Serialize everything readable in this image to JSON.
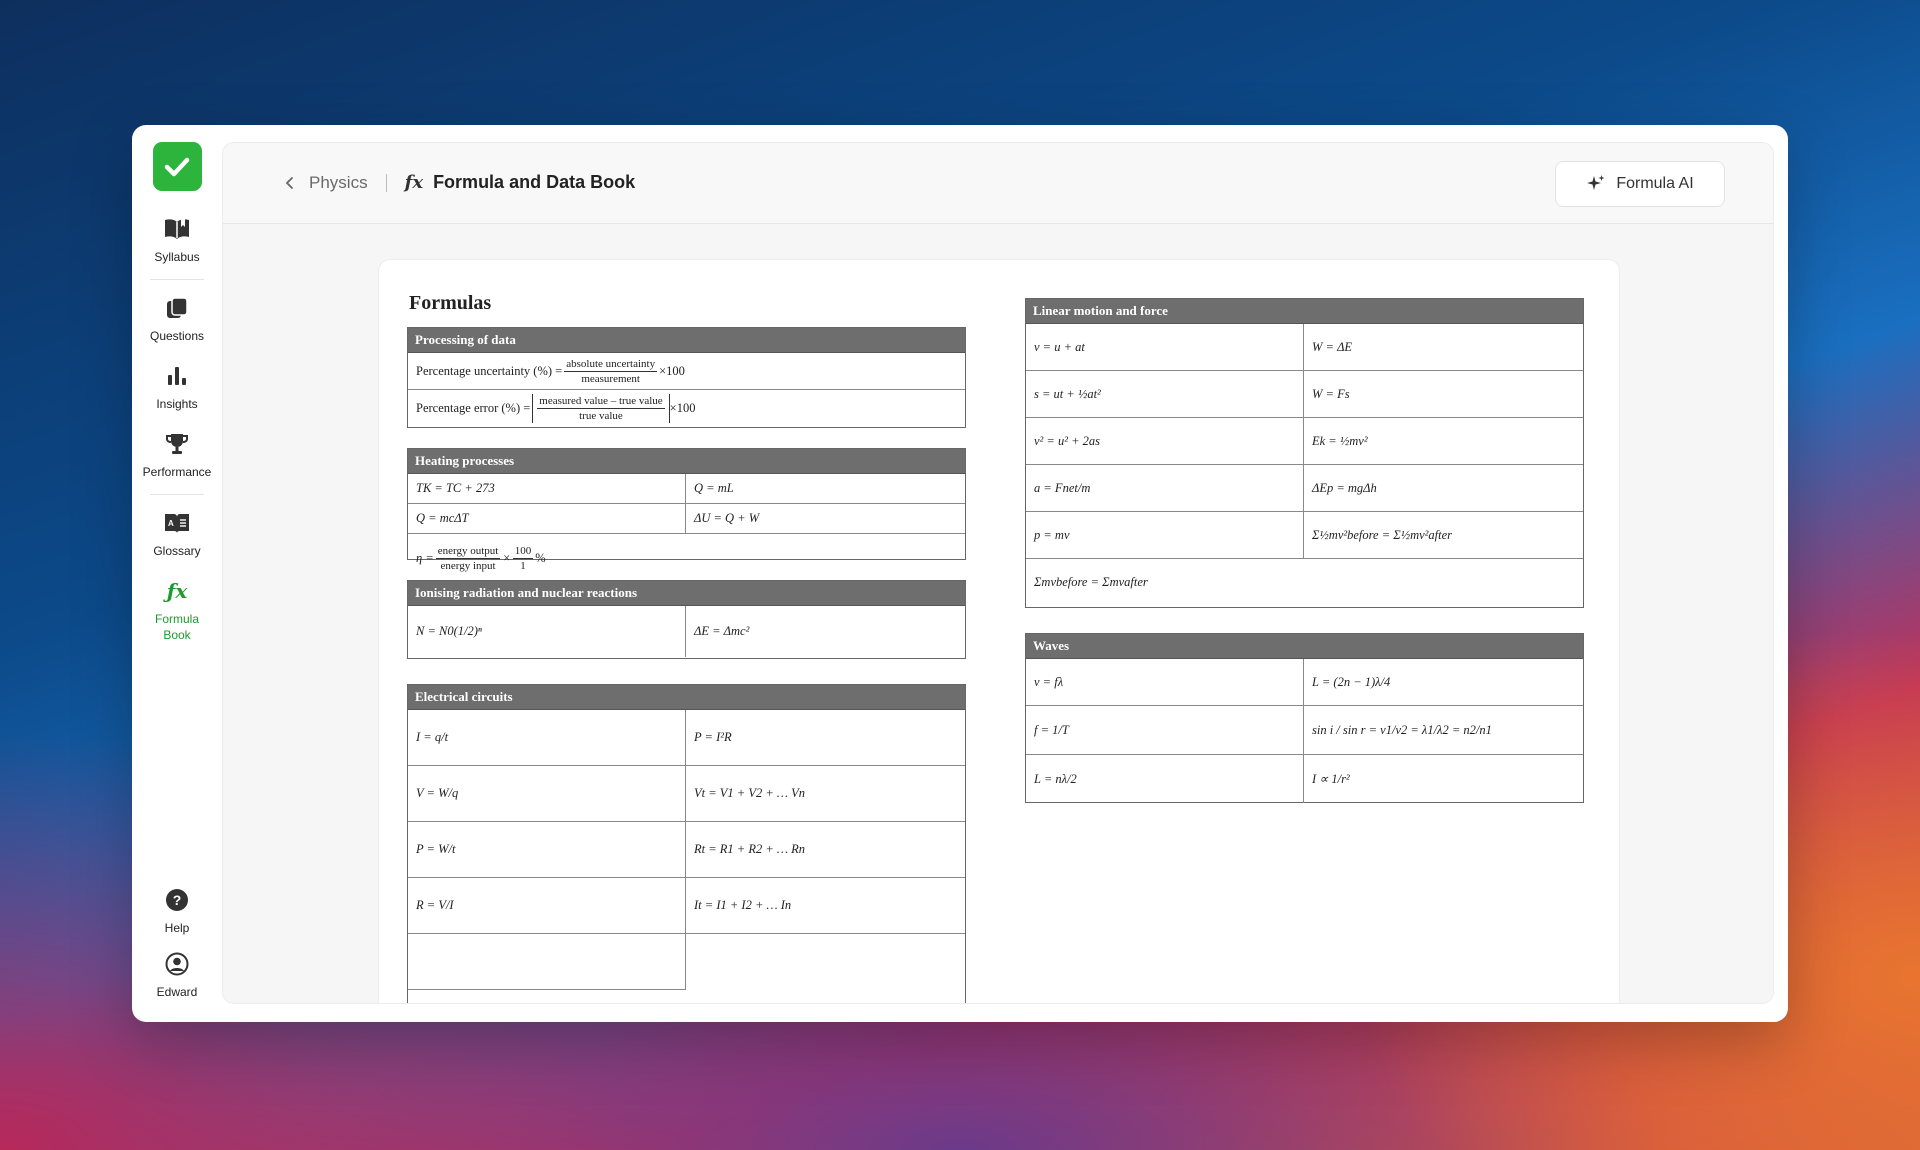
{
  "sidebar": {
    "items": [
      {
        "label": "Syllabus",
        "icon": "book-open-icon"
      },
      {
        "label": "Questions",
        "icon": "cards-icon"
      },
      {
        "label": "Insights",
        "icon": "bar-chart-icon"
      },
      {
        "label": "Performance",
        "icon": "trophy-icon"
      },
      {
        "label": "Glossary",
        "icon": "dictionary-icon"
      },
      {
        "label": "Formula Book",
        "icon": "fx-icon"
      }
    ],
    "help_label": "Help",
    "user_label": "Edward",
    "accent_color": "#1f9a2c"
  },
  "header": {
    "breadcrumb_parent": "Physics",
    "title_icon": "fx",
    "title": "Formula and Data Book",
    "ai_button": "Formula AI"
  },
  "doc": {
    "heading": "Formulas",
    "sections": {
      "processing": {
        "title": "Processing of data",
        "pct_uncertainty_lhs": "Percentage uncertainty (%) =",
        "pct_uncertainty_num": "absolute uncertainty",
        "pct_uncertainty_den": "measurement",
        "pct_uncertainty_mul": "×100",
        "pct_error_lhs": "Percentage error (%) =",
        "pct_error_num": "measured value – true value",
        "pct_error_den": "true value",
        "pct_error_mul": "×100"
      },
      "heating": {
        "title": "Heating processes",
        "f1": "TK = TC + 273",
        "f2": "Q = mL",
        "f3": "Q = mcΔT",
        "f4": "ΔU = Q + W",
        "eff_lhs": "η =",
        "eff_num": "energy output",
        "eff_den": "energy input",
        "eff_x": "×",
        "eff_num2": "100",
        "eff_den2": "1",
        "eff_unit": "%"
      },
      "ionising": {
        "title": "Ionising radiation and nuclear reactions",
        "f1": "N = N0(1/2)ⁿ",
        "f2": "ΔE = Δmc²"
      },
      "electrical": {
        "title": "Electrical circuits",
        "rows": [
          [
            "I = q/t",
            "P = I²R"
          ],
          [
            "V = W/q",
            "Vt = V1 + V2 + … Vn"
          ],
          [
            "P = W/t",
            "Rt = R1 + R2 + … Rn"
          ],
          [
            "R = V/I",
            "It = I1 + I2 + … In"
          ]
        ]
      },
      "linear": {
        "title": "Linear motion and force",
        "rows": [
          [
            "v = u + at",
            "W = ΔE"
          ],
          [
            "s = ut + ½at²",
            "W = Fs"
          ],
          [
            "v² = u² + 2as",
            "Ek = ½mv²"
          ],
          [
            "a = Fnet/m",
            "ΔEp = mgΔh"
          ],
          [
            "p = mv",
            "Σ½mv²before = Σ½mv²after"
          ]
        ],
        "last": "Σmvbefore = Σmvafter"
      },
      "waves": {
        "title": "Waves",
        "rows": [
          [
            "v = fλ",
            "L = (2n − 1)λ/4"
          ],
          [
            "f = 1/T",
            "sin i / sin r = v1/v2 = λ1/λ2 = n2/n1"
          ],
          [
            "L = nλ/2",
            "I ∝ 1/r²"
          ]
        ]
      }
    }
  }
}
